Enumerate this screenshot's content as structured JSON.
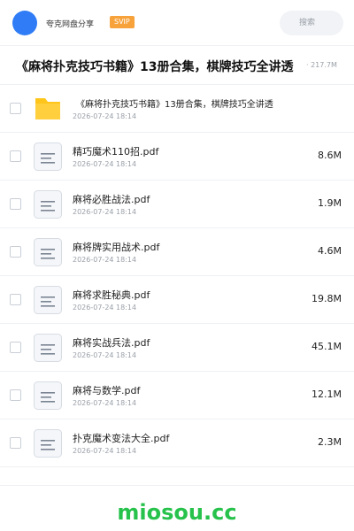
{
  "header": {
    "brand": "夸克网盘分享",
    "badge": "SVIP",
    "search_placeholder": "搜索"
  },
  "folder": {
    "title": "《麻将扑克技巧书籍》13册合集，棋牌技巧全讲透",
    "size": "· 217.7M"
  },
  "files": [
    {
      "name": "《麻将扑克技巧书籍》13册合集，棋牌技巧全讲透",
      "date": "2026-07-24 18:14",
      "size": "",
      "type": "folder"
    },
    {
      "name": "精巧魔术110招.pdf",
      "date": "2026-07-24 18:14",
      "size": "8.6M",
      "type": "file"
    },
    {
      "name": "麻将必胜战法.pdf",
      "date": "2026-07-24 18:14",
      "size": "1.9M",
      "type": "file"
    },
    {
      "name": "麻将牌实用战术.pdf",
      "date": "2026-07-24 18:14",
      "size": "4.6M",
      "type": "file"
    },
    {
      "name": "麻将求胜秘典.pdf",
      "date": "2026-07-24 18:14",
      "size": "19.8M",
      "type": "file"
    },
    {
      "name": "麻将实战兵法.pdf",
      "date": "2026-07-24 18:14",
      "size": "45.1M",
      "type": "file"
    },
    {
      "name": "麻将与数学.pdf",
      "date": "2026-07-24 18:14",
      "size": "12.1M",
      "type": "file"
    },
    {
      "name": "扑克魔术变法大全.pdf",
      "date": "2026-07-24 18:14",
      "size": "2.3M",
      "type": "file"
    }
  ],
  "footer": {
    "site": "miosou.cc"
  },
  "colors": {
    "accent": "#2f7cf6",
    "badge": "#f7a23a",
    "site_green": "#27c24c",
    "folder_yellow": "#ffc51a"
  }
}
